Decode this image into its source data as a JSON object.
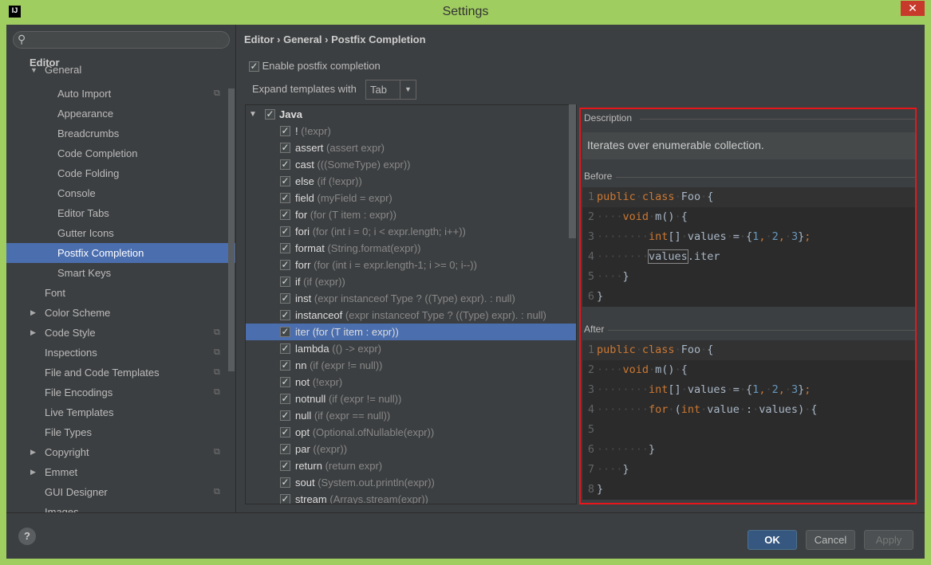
{
  "window": {
    "title": "Settings",
    "app_icon": "IJ"
  },
  "sidebar": {
    "header": "Editor",
    "items": [
      {
        "label": "General",
        "level": 1,
        "expanded": true
      },
      {
        "label": "Auto Import",
        "level": 2,
        "copy": true
      },
      {
        "label": "Appearance",
        "level": 2
      },
      {
        "label": "Breadcrumbs",
        "level": 2
      },
      {
        "label": "Code Completion",
        "level": 2
      },
      {
        "label": "Code Folding",
        "level": 2
      },
      {
        "label": "Console",
        "level": 2
      },
      {
        "label": "Editor Tabs",
        "level": 2
      },
      {
        "label": "Gutter Icons",
        "level": 2
      },
      {
        "label": "Postfix Completion",
        "level": 2,
        "selected": true
      },
      {
        "label": "Smart Keys",
        "level": 2
      },
      {
        "label": "Font",
        "level": 1
      },
      {
        "label": "Color Scheme",
        "level": 1,
        "collapsed": true
      },
      {
        "label": "Code Style",
        "level": 1,
        "collapsed": true,
        "copy": true
      },
      {
        "label": "Inspections",
        "level": 1,
        "copy": true
      },
      {
        "label": "File and Code Templates",
        "level": 1,
        "copy": true
      },
      {
        "label": "File Encodings",
        "level": 1,
        "copy": true
      },
      {
        "label": "Live Templates",
        "level": 1
      },
      {
        "label": "File Types",
        "level": 1
      },
      {
        "label": "Copyright",
        "level": 1,
        "collapsed": true,
        "copy": true
      },
      {
        "label": "Emmet",
        "level": 1,
        "collapsed": true
      },
      {
        "label": "GUI Designer",
        "level": 1,
        "copy": true
      },
      {
        "label": "Images",
        "level": 1
      }
    ]
  },
  "breadcrumb": [
    "Editor",
    "General",
    "Postfix Completion"
  ],
  "enable_label": "Enable postfix completion",
  "expand_label": "Expand templates with",
  "expand_value": "Tab",
  "templates": {
    "group": "Java",
    "items": [
      [
        "!",
        "(!expr)"
      ],
      [
        "assert",
        "(assert expr)"
      ],
      [
        "cast",
        "(((SomeType) expr))"
      ],
      [
        "else",
        "(if (!expr))"
      ],
      [
        "field",
        "(myField = expr)"
      ],
      [
        "for",
        "(for (T item : expr))"
      ],
      [
        "fori",
        "(for (int i = 0; i < expr.length; i++))"
      ],
      [
        "format",
        "(String.format(expr))"
      ],
      [
        "forr",
        "(for (int i = expr.length-1; i >= 0; i--))"
      ],
      [
        "if",
        "(if (expr))"
      ],
      [
        "inst",
        "(expr instanceof Type ? ((Type) expr). : null)"
      ],
      [
        "instanceof",
        "(expr instanceof Type ? ((Type) expr). : null)"
      ],
      [
        "iter",
        "(for (T item : expr))"
      ],
      [
        "lambda",
        "(() -> expr)"
      ],
      [
        "nn",
        "(if (expr != null))"
      ],
      [
        "not",
        "(!expr)"
      ],
      [
        "notnull",
        "(if (expr != null))"
      ],
      [
        "null",
        "(if (expr == null))"
      ],
      [
        "opt",
        "(Optional.ofNullable(expr))"
      ],
      [
        "par",
        "((expr))"
      ],
      [
        "return",
        "(return expr)"
      ],
      [
        "sout",
        "(System.out.println(expr))"
      ],
      [
        "stream",
        "(Arrays.stream(expr))"
      ]
    ],
    "selected": "iter"
  },
  "description": {
    "label": "Description",
    "text": "Iterates over enumerable collection."
  },
  "before": {
    "label": "Before",
    "lines": [
      [
        [
          "public",
          "kw"
        ],
        [
          "·",
          "ws"
        ],
        [
          "class",
          "kw"
        ],
        [
          "·",
          "ws"
        ],
        [
          "Foo",
          "pl"
        ],
        [
          "·",
          "ws"
        ],
        [
          "{",
          "pl"
        ]
      ],
      [
        [
          "····",
          "ws"
        ],
        [
          "void",
          "kw"
        ],
        [
          "·",
          "ws"
        ],
        [
          "m()",
          "pl"
        ],
        [
          "·",
          "ws"
        ],
        [
          "{",
          "pl"
        ]
      ],
      [
        [
          "········",
          "ws"
        ],
        [
          "int",
          "kw"
        ],
        [
          "[]",
          "pl"
        ],
        [
          "·",
          "ws"
        ],
        [
          "values",
          "pl"
        ],
        [
          "·",
          "ws"
        ],
        [
          "=",
          "pl"
        ],
        [
          "·",
          "ws"
        ],
        [
          "{",
          "pl"
        ],
        [
          "1",
          "num"
        ],
        [
          ",",
          "kw"
        ],
        [
          "·",
          "ws"
        ],
        [
          "2",
          "num"
        ],
        [
          ",",
          "kw"
        ],
        [
          "·",
          "ws"
        ],
        [
          "3",
          "num"
        ],
        [
          "}",
          "pl"
        ],
        [
          ";",
          "kw"
        ]
      ],
      [
        [
          "········",
          "ws"
        ],
        [
          "values",
          "box"
        ],
        [
          ".iter",
          "pl"
        ]
      ],
      [
        [
          "····",
          "ws"
        ],
        [
          "}",
          "pl"
        ]
      ],
      [
        [
          "}",
          "pl"
        ]
      ]
    ]
  },
  "after": {
    "label": "After",
    "lines": [
      [
        [
          "public",
          "kw"
        ],
        [
          "·",
          "ws"
        ],
        [
          "class",
          "kw"
        ],
        [
          "·",
          "ws"
        ],
        [
          "Foo",
          "pl"
        ],
        [
          "·",
          "ws"
        ],
        [
          "{",
          "pl"
        ]
      ],
      [
        [
          "····",
          "ws"
        ],
        [
          "void",
          "kw"
        ],
        [
          "·",
          "ws"
        ],
        [
          "m()",
          "pl"
        ],
        [
          "·",
          "ws"
        ],
        [
          "{",
          "pl"
        ]
      ],
      [
        [
          "········",
          "ws"
        ],
        [
          "int",
          "kw"
        ],
        [
          "[]",
          "pl"
        ],
        [
          "·",
          "ws"
        ],
        [
          "values",
          "pl"
        ],
        [
          "·",
          "ws"
        ],
        [
          "=",
          "pl"
        ],
        [
          "·",
          "ws"
        ],
        [
          "{",
          "pl"
        ],
        [
          "1",
          "num"
        ],
        [
          ",",
          "kw"
        ],
        [
          "·",
          "ws"
        ],
        [
          "2",
          "num"
        ],
        [
          ",",
          "kw"
        ],
        [
          "·",
          "ws"
        ],
        [
          "3",
          "num"
        ],
        [
          "}",
          "pl"
        ],
        [
          ";",
          "kw"
        ]
      ],
      [
        [
          "········",
          "ws"
        ],
        [
          "for",
          "kw"
        ],
        [
          "·",
          "ws"
        ],
        [
          "(",
          "pl"
        ],
        [
          "int",
          "kw"
        ],
        [
          "·",
          "ws"
        ],
        [
          "value",
          "pl"
        ],
        [
          "·",
          "ws"
        ],
        [
          ":",
          "pl"
        ],
        [
          "·",
          "ws"
        ],
        [
          "values)",
          "pl"
        ],
        [
          "·",
          "ws"
        ],
        [
          "{",
          "pl"
        ]
      ],
      [],
      [
        [
          "········",
          "ws"
        ],
        [
          "}",
          "pl"
        ]
      ],
      [
        [
          "····",
          "ws"
        ],
        [
          "}",
          "pl"
        ]
      ],
      [
        [
          "}",
          "pl"
        ]
      ]
    ]
  },
  "buttons": {
    "ok": "OK",
    "cancel": "Cancel",
    "apply": "Apply",
    "help": "?"
  },
  "colors": {
    "selection": "#4b6eaf",
    "highlight_border": "#e8161a",
    "keyword": "#cc7832",
    "number": "#6897bb"
  }
}
